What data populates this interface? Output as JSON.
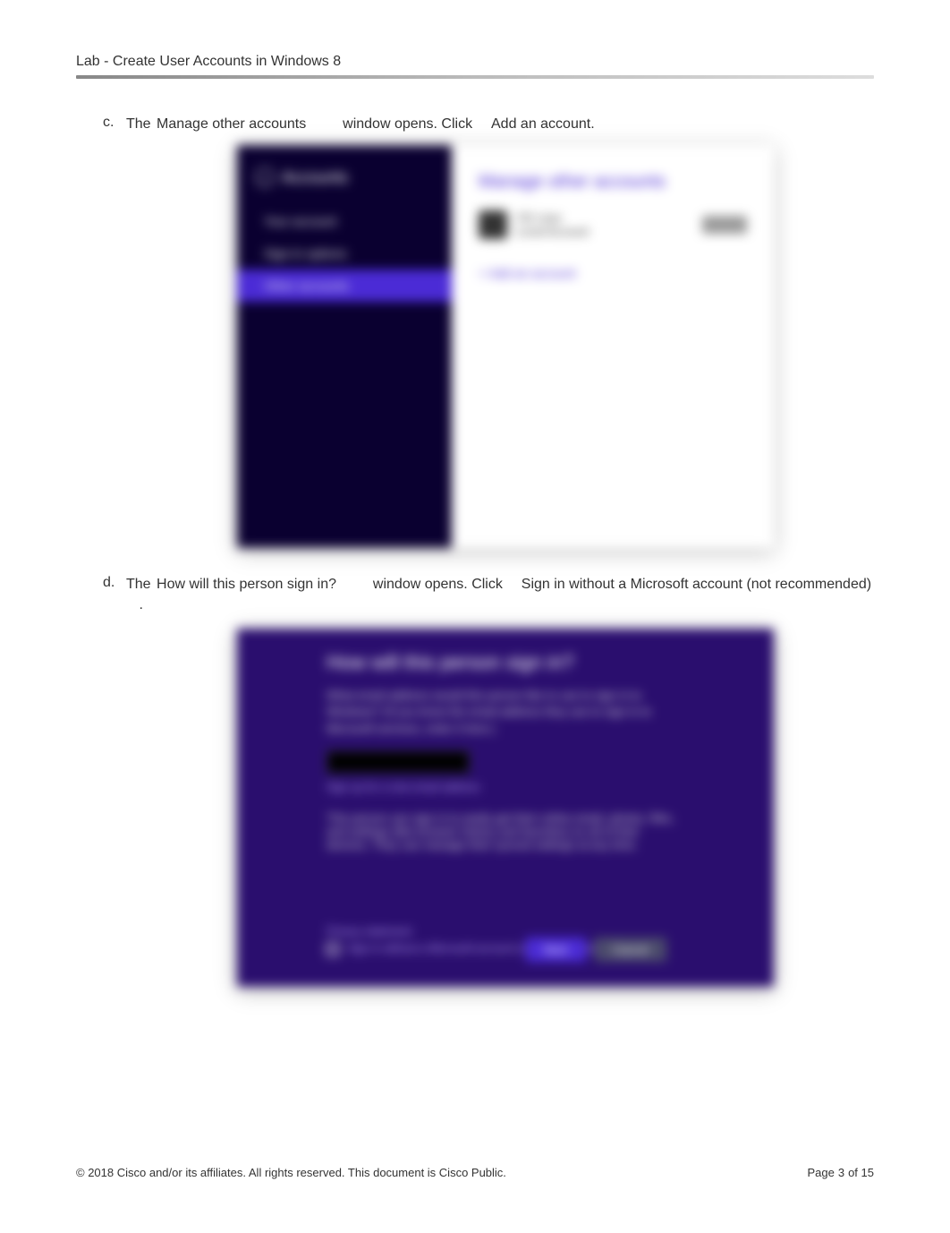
{
  "header": {
    "title": "Lab - Create User Accounts in Windows 8"
  },
  "steps": {
    "c": {
      "letter": "c.",
      "t1": "The ",
      "bold1": "Manage other accounts",
      "t2": " window opens. Click ",
      "bold2": "Add an account."
    },
    "d": {
      "letter": "d.",
      "t1": "The ",
      "bold1": "How will this person sign in?",
      "t2": " window opens. Click ",
      "bold2": "Sign in without a Microsoft account (not recommended)",
      "t3": "."
    }
  },
  "screenshot1": {
    "panel_title": "Accounts",
    "nav0": "Your account",
    "nav1": "Sign-in options",
    "nav2": "Other accounts",
    "right_title": "Manage other accounts",
    "user_name": "ITE User",
    "user_role": "Local Account",
    "add_link": "+ Add an account"
  },
  "screenshot2": {
    "heading": "How will this person sign in?",
    "desc": "What email address would this person like to use to sign in to Windows? (If you know the email address they use to sign in to Microsoft services, enter it here.)",
    "subtext": "Sign up for a new email address",
    "benefit": "This person can sign in to easily get their online email, photos, files, and settings (like browser history and favorites) on all of their devices. They can manage their synced settings at any time.",
    "opt1": "Privacy statement",
    "opt2": "Sign in without a Microsoft account (not recommended)",
    "btn_next": "Next",
    "btn_cancel": "Cancel"
  },
  "footer": {
    "copyright": "© 2018 Cisco and/or its affiliates. All rights reserved. This document is Cisco Public.",
    "page_label": "Page ",
    "page_current": "3",
    "page_of": " of 15"
  }
}
